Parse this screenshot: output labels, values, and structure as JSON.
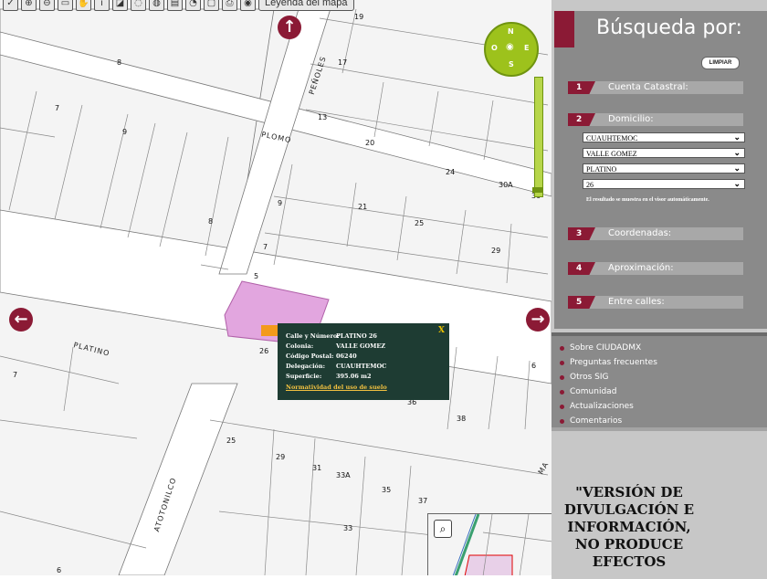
{
  "toolbar": {
    "legend_label": "Leyenda del mapa"
  },
  "map": {
    "street_labels": [
      "PLOMO",
      "PEÑOLES",
      "PLATINO",
      "ATOTONILCO",
      "MA"
    ],
    "lot_numbers": [
      "8",
      "7",
      "9",
      "8",
      "17",
      "13",
      "20",
      "19",
      "24",
      "30A",
      "30",
      "9",
      "21",
      "25",
      "29",
      "7",
      "5",
      "26",
      "6",
      "36",
      "38",
      "7",
      "25",
      "29",
      "31",
      "33A",
      "35",
      "37",
      "33",
      "6"
    ],
    "popup": {
      "fields": [
        {
          "label": "Calle y Número:",
          "value": "PLATINO 26"
        },
        {
          "label": "Colonia:",
          "value": "VALLE GOMEZ"
        },
        {
          "label": "Código Postal:",
          "value": "06240"
        },
        {
          "label": "Delegación:",
          "value": "CUAUHTEMOC"
        },
        {
          "label": "Superficie:",
          "value": "395.06 m2"
        }
      ],
      "link": "Normatividad del uso de suelo",
      "close": "X"
    },
    "compass": {
      "n": "N",
      "s": "S",
      "e": "E",
      "o": "O"
    },
    "colors": {
      "highlight": "#e2a6df",
      "accent": "#8b1a35",
      "compass": "#9dc21c",
      "popup": "#1e3c33"
    }
  },
  "panel": {
    "title": "Búsqueda por:",
    "clear_label": "LIMPIAR",
    "sections": [
      {
        "num": "1",
        "label": "Cuenta Catastral:"
      },
      {
        "num": "2",
        "label": "Domicilio:"
      },
      {
        "num": "3",
        "label": "Coordenadas:"
      },
      {
        "num": "4",
        "label": "Aproximación:"
      },
      {
        "num": "5",
        "label": "Entre calles:"
      }
    ],
    "address_selects": [
      "CUAUHTEMOC",
      "VALLE GOMEZ",
      "PLATINO",
      "26"
    ],
    "result_note": "El resultado se muestra en el visor automáticamente.",
    "links": [
      "Sobre CIUDADMX",
      "Preguntas frecuentes",
      "Otros SIG",
      "Comunidad",
      "Actualizaciones",
      "Comentarios"
    ],
    "disclaimer": "\"VERSIÓN DE DIVULGACIÓN E INFORMACIÓN, NO PRODUCE EFECTOS"
  }
}
